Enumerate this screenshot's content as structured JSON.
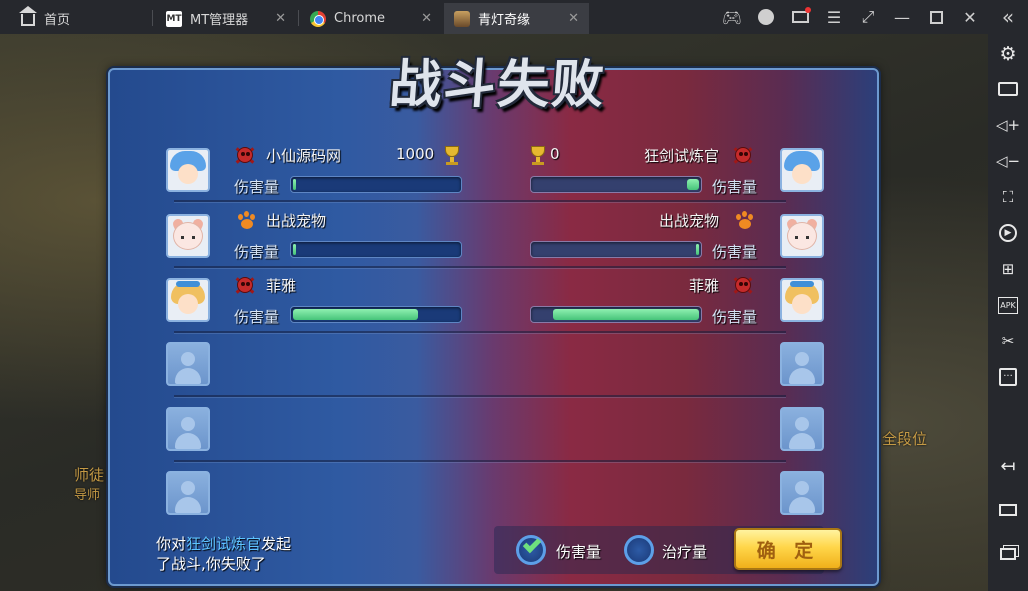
{
  "tabs": [
    {
      "label": "首页",
      "icon": "home-icon"
    },
    {
      "label": "MT管理器",
      "icon": "mt-manager-icon"
    },
    {
      "label": "Chrome",
      "icon": "chrome-icon"
    },
    {
      "label": "青灯奇缘",
      "icon": "game-app-icon",
      "active": true
    }
  ],
  "topbar_buttons": [
    "gamepad-icon",
    "account-icon",
    "mail-icon",
    "menu-icon",
    "pin-icon",
    "minimize-icon",
    "maximize-icon",
    "close-icon",
    "collapse-sidebar-icon"
  ],
  "sidebar_buttons": [
    "settings-icon",
    "keyboard-icon",
    "volume-up-icon",
    "volume-down-icon",
    "screenshot-icon",
    "record-icon",
    "add-app-icon",
    "apk-install-icon",
    "scissors-icon",
    "more-icon",
    "back-icon",
    "home-icon",
    "recent-apps-icon"
  ],
  "dialog": {
    "title": "战斗失败",
    "left": {
      "player": {
        "name": "小仙源码网",
        "score": "1000",
        "damage_label": "伤害量",
        "damage": 0.01
      },
      "pet": {
        "name": "出战宠物",
        "damage_label": "伤害量",
        "damage": 0.01
      },
      "ally": {
        "name": "菲雅",
        "damage_label": "伤害量",
        "damage": 0.75
      }
    },
    "right": {
      "player": {
        "name": "狂剑试炼官",
        "score": "0",
        "damage_label": "伤害量",
        "damage": 0.07
      },
      "pet": {
        "name": "出战宠物",
        "damage_label": "伤害量",
        "damage": 0.01
      },
      "ally": {
        "name": "菲雅",
        "damage_label": "伤害量",
        "damage": 0.88
      }
    },
    "footer": {
      "msg_prefix": "你对",
      "opponent": "狂剑试炼官",
      "msg_suffix": "发起",
      "msg_line2": "了战斗,你失败了",
      "option_damage": "伤害量",
      "option_heal": "治疗量",
      "confirm": "确 定"
    }
  },
  "background_text": {
    "left_1": "师徒",
    "left_2": "导师",
    "right": "全段位"
  },
  "colors": {
    "win_bar": "#46c47a",
    "dialog_blue": "#2f5aa2",
    "dialog_red": "#8a2a44",
    "confirm_gold": "#ffd64a"
  }
}
